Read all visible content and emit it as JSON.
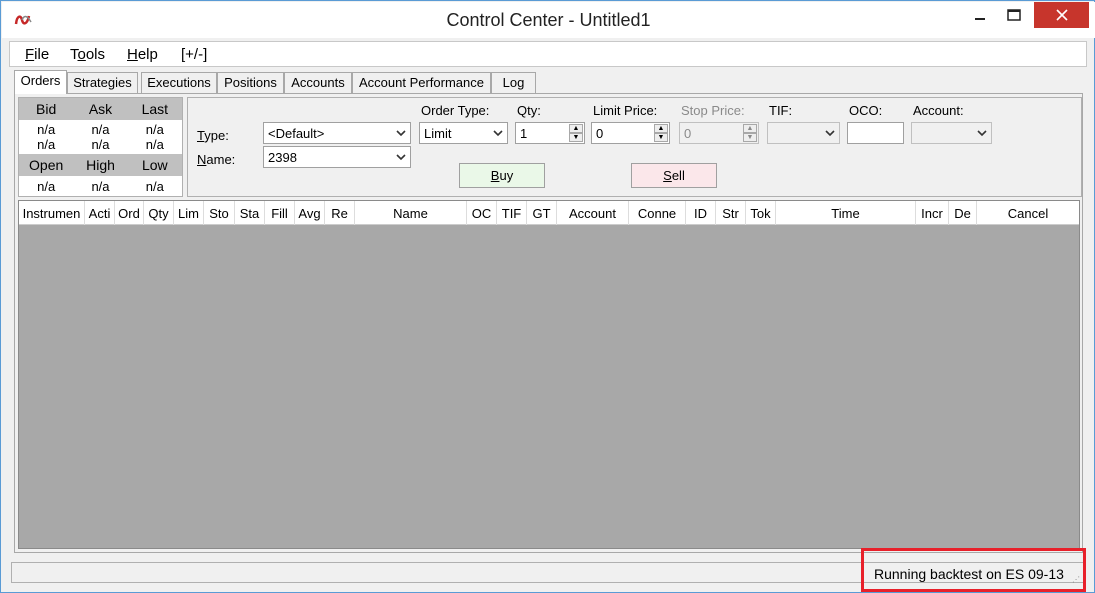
{
  "window": {
    "title": "Control Center - Untitled1"
  },
  "menu": {
    "file": "File",
    "file_u": "F",
    "file_rest": "ile",
    "tools_pre": "T",
    "tools_u": "o",
    "tools_rest": "ols",
    "help_u": "H",
    "help_rest": "elp",
    "toggle": "[+/-]"
  },
  "tabs": [
    "Orders",
    "Strategies",
    "Executions",
    "Positions",
    "Accounts",
    "Account Performance",
    "Log"
  ],
  "quotes": {
    "headers1": [
      "Bid",
      "Ask",
      "Last"
    ],
    "row1": [
      "n/a",
      "n/a",
      "n/a"
    ],
    "row2": [
      "n/a",
      "n/a",
      "n/a"
    ],
    "headers2": [
      "Open",
      "High",
      "Low"
    ],
    "row3": [
      "n/a",
      "n/a",
      "n/a"
    ]
  },
  "entry": {
    "type_label_u": "T",
    "type_label_rest": "ype:",
    "type_value": "<Default>",
    "name_label_u": "N",
    "name_label_rest": "ame:",
    "name_value": "2398",
    "order_type_label": "Order Type:",
    "order_type_value": "Limit",
    "qty_label": "Qty:",
    "qty_value": "1",
    "limit_price_label": "Limit Price:",
    "limit_price_value": "0",
    "stop_price_label": "Stop Price:",
    "stop_price_value": "0",
    "tif_label": "TIF:",
    "tif_value": "",
    "oco_label": "OCO:",
    "oco_value": "",
    "account_label": "Account:",
    "account_value": "",
    "buy_u": "B",
    "buy_rest": "uy",
    "sell_u": "S",
    "sell_rest": "ell"
  },
  "grid": {
    "columns": [
      "Instrumen",
      "Acti",
      "Ord",
      "Qty",
      "Lim",
      "Sto",
      "Sta",
      "Fill",
      "Avg",
      "Re",
      "Name",
      "OC",
      "TIF",
      "GT",
      "Account",
      "Conne",
      "ID",
      "Str",
      "Tok",
      "Time",
      "Incr",
      "De",
      "Cancel"
    ]
  },
  "status": {
    "text": "Running backtest on ES 09-13"
  },
  "colors": {
    "buy": "#eaf8e8",
    "sell": "#fbe7ea",
    "highlight": "#e8202a",
    "close": "#c7352c"
  }
}
